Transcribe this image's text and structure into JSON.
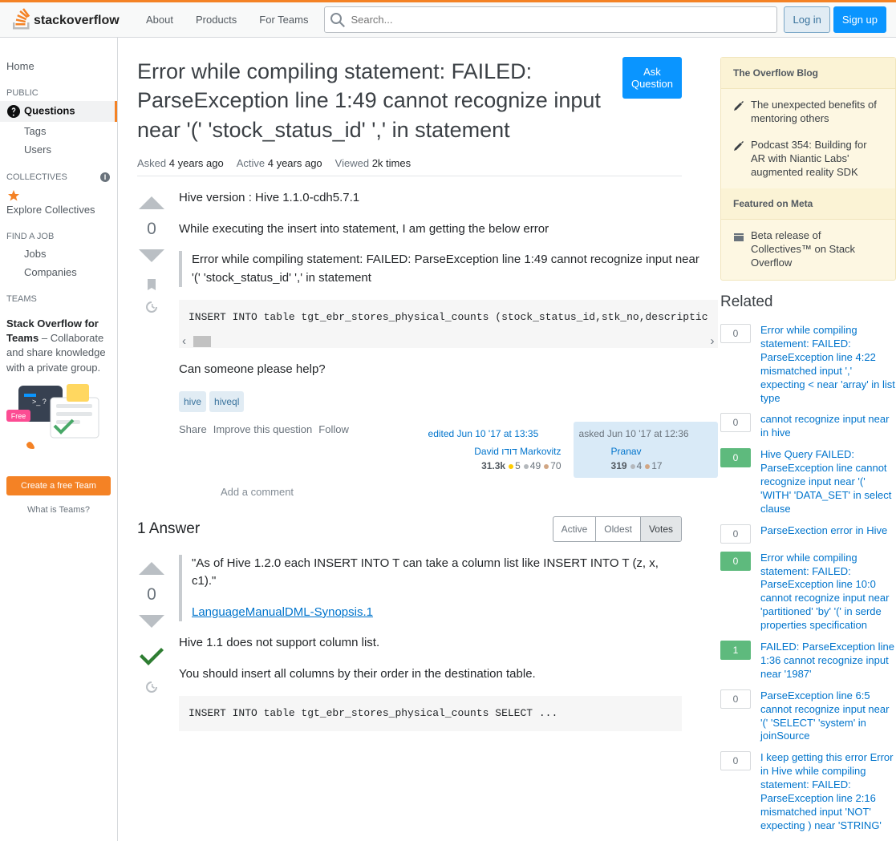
{
  "header": {
    "nav": [
      "About",
      "Products",
      "For Teams"
    ],
    "search_placeholder": "Search...",
    "login": "Log in",
    "signup": "Sign up"
  },
  "sidebar": {
    "home": "Home",
    "public_label": "PUBLIC",
    "public_items": [
      "Questions",
      "Tags",
      "Users"
    ],
    "collectives_label": "COLLECTIVES",
    "explore": "Explore Collectives",
    "findjob_label": "FIND A JOB",
    "job_items": [
      "Jobs",
      "Companies"
    ],
    "teams_label": "TEAMS",
    "teams_title": "Stack Overflow for Teams",
    "teams_desc": " – Collaborate and share knowledge with a private group.",
    "teams_free": "Free",
    "create_team": "Create a free Team",
    "what_teams": "What is Teams?"
  },
  "question": {
    "title": "Error while compiling statement: FAILED: ParseException line 1:49 cannot recognize input near '(' 'stock_status_id' ',' in statement",
    "ask_btn": "Ask Question",
    "asked_label": "Asked",
    "asked_val": "4 years ago",
    "active_label": "Active",
    "active_val": "4 years ago",
    "viewed_label": "Viewed",
    "viewed_val": "2k times",
    "vote": "0",
    "body_p1": "Hive version : Hive 1.1.0-cdh5.7.1",
    "body_p2": "While executing the insert into statement, I am getting the below error",
    "blockquote": "Error while compiling statement: FAILED: ParseException line 1:49 cannot recognize input near '(' 'stock_status_id' ',' in statement",
    "code": "INSERT INTO table tgt_ebr_stores_physical_counts (stock_status_id,stk_no,descriptic",
    "body_p3": "Can someone please help?",
    "tags": [
      "hive",
      "hiveql"
    ],
    "share": "Share",
    "improve": "Improve this question",
    "follow": "Follow",
    "edited": "edited Jun 10 '17 at 13:35",
    "editor_name": "David דודו Markovitz",
    "editor_rep": "31.3k",
    "editor_gold": "5",
    "editor_silver": "49",
    "editor_bronze": "70",
    "asked_time": "asked Jun 10 '17 at 12:36",
    "owner_name": "Pranav",
    "owner_rep": "319",
    "owner_silver": "4",
    "owner_bronze": "17",
    "add_comment": "Add a comment"
  },
  "answers": {
    "title": "1 Answer",
    "tabs": [
      "Active",
      "Oldest",
      "Votes"
    ],
    "vote": "0",
    "quote": "\"As of Hive 1.2.0 each INSERT INTO T can take a column list like INSERT INTO T (z, x, c1).\"",
    "link": "LanguageManualDML-Synopsis.1",
    "p1": "Hive 1.1 does not support column list.",
    "p2": "You should insert all columns by their order in the destination table.",
    "code": "INSERT INTO table tgt_ebr_stores_physical_counts SELECT ..."
  },
  "right": {
    "blog_title": "The Overflow Blog",
    "blog_items": [
      "The unexpected benefits of mentoring others",
      "Podcast 354: Building for AR with Niantic Labs' augmented reality SDK"
    ],
    "meta_title": "Featured on Meta",
    "meta_items": [
      "Beta release of Collectives™ on Stack Overflow"
    ],
    "related_title": "Related",
    "related": [
      {
        "score": "0",
        "answered": false,
        "title": "Error while compiling statement: FAILED: ParseException line 4:22 mismatched input ',' expecting < near 'array' in list type"
      },
      {
        "score": "0",
        "answered": false,
        "title": "cannot recognize input near in hive"
      },
      {
        "score": "0",
        "answered": true,
        "title": "Hive Query FAILED: ParseException line cannot recognize input near '(' 'WITH' 'DATA_SET' in select clause"
      },
      {
        "score": "0",
        "answered": false,
        "title": "ParseExection error in Hive"
      },
      {
        "score": "0",
        "answered": true,
        "title": "Error while compiling statement: FAILED: ParseException line 10:0 cannot recognize input near 'partitioned' 'by' '(' in serde properties specification"
      },
      {
        "score": "1",
        "answered": true,
        "title": "FAILED: ParseException line 1:36 cannot recognize input near '1987'"
      },
      {
        "score": "0",
        "answered": false,
        "title": "ParseException line 6:5 cannot recognize input near '(' 'SELECT' 'system' in joinSource"
      },
      {
        "score": "0",
        "answered": false,
        "title": "I keep getting this error Error in Hive while compiling statement: FAILED: ParseException line 2:16 mismatched input 'NOT' expecting ) near 'STRING'"
      }
    ]
  }
}
